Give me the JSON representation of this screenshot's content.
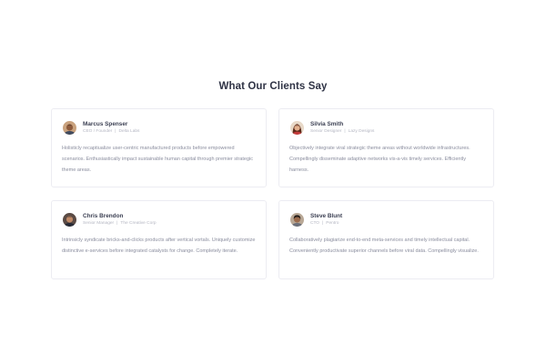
{
  "section": {
    "title": "What Our Clients Say"
  },
  "testimonials": [
    {
      "name": "Marcus Spenser",
      "role": "CEO / Founder",
      "company": "Delta Labs",
      "separator": "|",
      "quote": "Holisticly recaptiualize user-centric manufactured products before empowered scenarios. Enthusiastically impact sustainable human capital through premier strategic theme areas.",
      "avatar_colors": {
        "bg": "#c9a27e",
        "skin": "#8d5b3c",
        "hair": "#2e2420",
        "shirt": "#3f4a5e"
      }
    },
    {
      "name": "Silvia Smith",
      "role": "Senior Designer",
      "company": "Lazy Designs",
      "separator": "|",
      "quote": "Objectively integrate viral strategic theme areas without worldwide infrastructures. Compellingly disseminate adaptive networks vis-a-vis timely services. Efficiently harness.",
      "avatar_colors": {
        "bg": "#e8d9c8",
        "skin": "#e2b08e",
        "hair": "#5a2a1a",
        "shirt": "#c23a3a"
      }
    },
    {
      "name": "Chris Brendon",
      "role": "Senior Manager",
      "company": "The Creative Corp",
      "separator": "|",
      "quote": "Intrinsicly syndicate bricks-and-clicks products after vertical vortals. Uniquely customize distinctive e-services before integrated catalysts for change. Completely iterate.",
      "avatar_colors": {
        "bg": "#5a4a44",
        "skin": "#c08a68",
        "hair": "#1e1a18",
        "shirt": "#262a36"
      }
    },
    {
      "name": "Steve Blunt",
      "role": "CTO",
      "company": "Pentro",
      "separator": "|",
      "quote": "Collaboratively plagiarize end-to-end meta-services and timely intellectual capital. Conveniently productivate superior channels before viral data. Compellingly visualize.",
      "avatar_colors": {
        "bg": "#b9a896",
        "skin": "#9a6a4c",
        "hair": "#231c19",
        "shirt": "#6b6f7a"
      }
    }
  ]
}
